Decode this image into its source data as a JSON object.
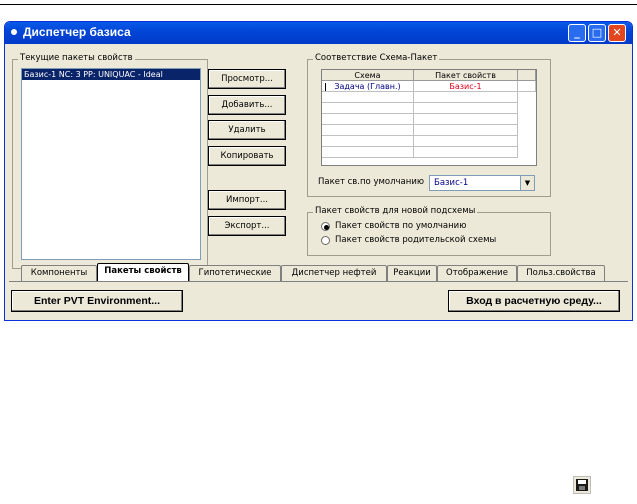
{
  "window": {
    "title": "Диспетчер базиса",
    "min_label": "_",
    "max_label": "□",
    "close_label": "✕"
  },
  "packages": {
    "group_label": "Текущие пакеты свойств",
    "selected_item": "Базис-1    NC: 3    PP: UNIQUAC - Ideal"
  },
  "actions": {
    "view": "Просмотр...",
    "add": "Добавить...",
    "delete": "Удалить",
    "copy": "Копировать",
    "import": "Импорт...",
    "export": "Экспорт..."
  },
  "mapping": {
    "group_label": "Соответствие Схема-Пакет",
    "columns": [
      "Схема",
      "Пакет свойств"
    ],
    "rows": [
      {
        "scheme": "Задача (Главн.)",
        "package": "Базис-1"
      }
    ],
    "default_label": "Пакет св.по умолчанию",
    "default_value": "Базис-1",
    "scheme_color": "#00008b",
    "package_color": "#e0001a"
  },
  "new_subschema": {
    "group_label": "Пакет свойств для новой подсхемы",
    "option_default": "Пакет свойств по умолчанию",
    "option_parent": "Пакет свойств родительской схемы",
    "selected": "default"
  },
  "tabs": [
    "Компоненты",
    "Пакеты свойств",
    "Гипотетические",
    "Диспетчер нефтей",
    "Реакции",
    "Отображение",
    "Польз.свойства"
  ],
  "active_tab": "Пакеты свойств",
  "bottom": {
    "pvt_button": "Enter PVT Environment...",
    "calc_button": "Вход в расчетную среду..."
  },
  "icons": {
    "save": "floppy-disk-icon"
  }
}
